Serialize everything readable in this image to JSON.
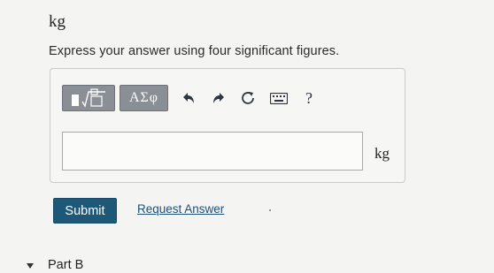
{
  "header": {
    "unit": "kg"
  },
  "instruction": "Express your answer using four significant figures.",
  "toolbar": {
    "templates_button": "templates-icon",
    "symbols_button_label": "ΑΣφ",
    "undo": "undo-icon",
    "redo": "redo-icon",
    "reset": "reset-icon",
    "keyboard": "keyboard-icon",
    "help_label": "?"
  },
  "answer": {
    "value": "",
    "unit": "kg"
  },
  "actions": {
    "submit_label": "Submit",
    "request_label": "Request Answer"
  },
  "next_part": {
    "label": "Part B"
  }
}
